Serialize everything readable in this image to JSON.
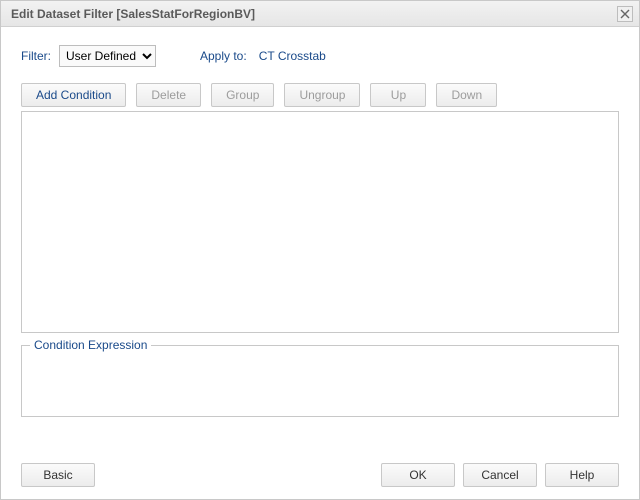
{
  "titlebar": {
    "title": "Edit Dataset Filter [SalesStatForRegionBV]"
  },
  "filter": {
    "label": "Filter:",
    "selected": "User Defined",
    "apply_label": "Apply to:",
    "apply_value": "CT Crosstab"
  },
  "toolbar": {
    "add_condition": "Add Condition",
    "delete": "Delete",
    "group": "Group",
    "ungroup": "Ungroup",
    "up": "Up",
    "down": "Down"
  },
  "condition_expression": {
    "legend": "Condition Expression"
  },
  "footer": {
    "basic": "Basic",
    "ok": "OK",
    "cancel": "Cancel",
    "help": "Help"
  }
}
